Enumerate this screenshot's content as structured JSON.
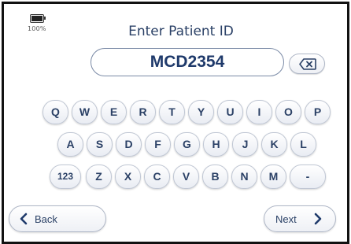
{
  "status": {
    "battery_percent": "100%"
  },
  "header": {
    "title": "Enter Patient ID"
  },
  "patient_id": {
    "value": "MCD2354"
  },
  "icons": {
    "backspace": "backspace-icon",
    "back": "chevron-left-icon",
    "next": "chevron-right-icon",
    "battery": "battery-icon"
  },
  "keyboard": {
    "row1": [
      "Q",
      "W",
      "E",
      "R",
      "T",
      "Y",
      "U",
      "I",
      "O",
      "P"
    ],
    "row2": [
      "A",
      "S",
      "D",
      "F",
      "G",
      "H",
      "J",
      "K",
      "L"
    ],
    "row3": [
      "123",
      "Z",
      "X",
      "C",
      "V",
      "B",
      "N",
      "M",
      "-"
    ]
  },
  "nav": {
    "back_label": "Back",
    "next_label": "Next"
  },
  "colors": {
    "accent_text": "#2b4166",
    "title": "#2a4066",
    "border": "#111111"
  }
}
